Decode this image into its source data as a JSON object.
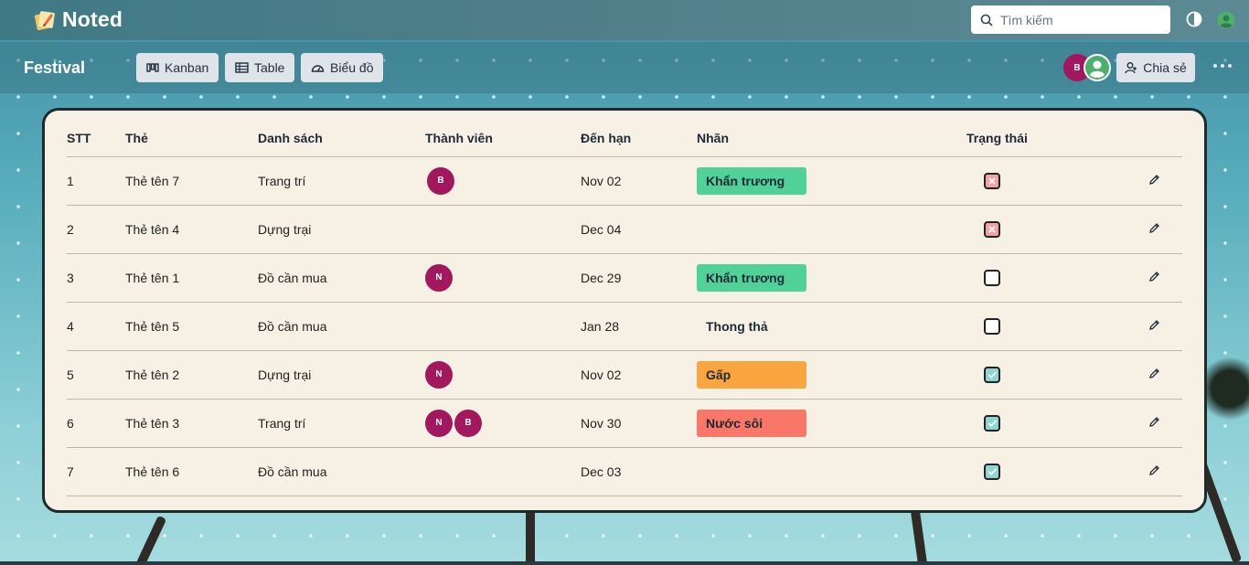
{
  "app": {
    "name": "Noted"
  },
  "search": {
    "placeholder": "Tìm kiếm"
  },
  "board": {
    "title": "Festival"
  },
  "views": [
    {
      "label": "Kanban",
      "icon": "kanban-icon"
    },
    {
      "label": "Table",
      "icon": "table-icon"
    },
    {
      "label": "Biểu đồ",
      "icon": "gauge-icon"
    }
  ],
  "header_members": [
    {
      "initial": "B"
    }
  ],
  "share": {
    "label": "Chia sẻ"
  },
  "table": {
    "columns": [
      "STT",
      "Thẻ",
      "Danh sách",
      "Thành viên",
      "Đến hạn",
      "Nhãn",
      "Trạng thái",
      ""
    ],
    "rows": [
      {
        "stt": "1",
        "card": "Thẻ tên 7",
        "list": "Trang trí",
        "members": [
          "B"
        ],
        "due": "Nov 02",
        "label": "Khẩn trương",
        "label_color": "#4fd197",
        "status": "failed"
      },
      {
        "stt": "2",
        "card": "Thẻ tên 4",
        "list": "Dựng trại",
        "members": [],
        "due": "Dec 04",
        "label": "",
        "label_color": "",
        "status": "failed"
      },
      {
        "stt": "3",
        "card": "Thẻ tên 1",
        "list": "Đồ cần mua",
        "members": [
          "N"
        ],
        "due": "Dec 29",
        "label": "Khẩn trương",
        "label_color": "#4fd197",
        "status": "empty"
      },
      {
        "stt": "4",
        "card": "Thẻ tên 5",
        "list": "Đồ cần mua",
        "members": [],
        "due": "Jan 28",
        "label": "Thong thả",
        "label_color": "",
        "status": "empty"
      },
      {
        "stt": "5",
        "card": "Thẻ tên 2",
        "list": "Dựng trại",
        "members": [
          "N"
        ],
        "due": "Nov 02",
        "label": "Gấp",
        "label_color": "#f9a540",
        "status": "done"
      },
      {
        "stt": "6",
        "card": "Thẻ tên 3",
        "list": "Trang trí",
        "members": [
          "N",
          "B"
        ],
        "due": "Nov 30",
        "label": "Nước sôi",
        "label_color": "#f87769",
        "status": "done"
      },
      {
        "stt": "7",
        "card": "Thẻ tên 6",
        "list": "Đồ cần mua",
        "members": [],
        "due": "Dec 03",
        "label": "",
        "label_color": "",
        "status": "done"
      }
    ]
  },
  "colors": {
    "avatar": "#a3175c",
    "status_failed": "#f4a3a3",
    "status_done": "#8fd6d0",
    "panel_bg": "#f7f1e5"
  }
}
